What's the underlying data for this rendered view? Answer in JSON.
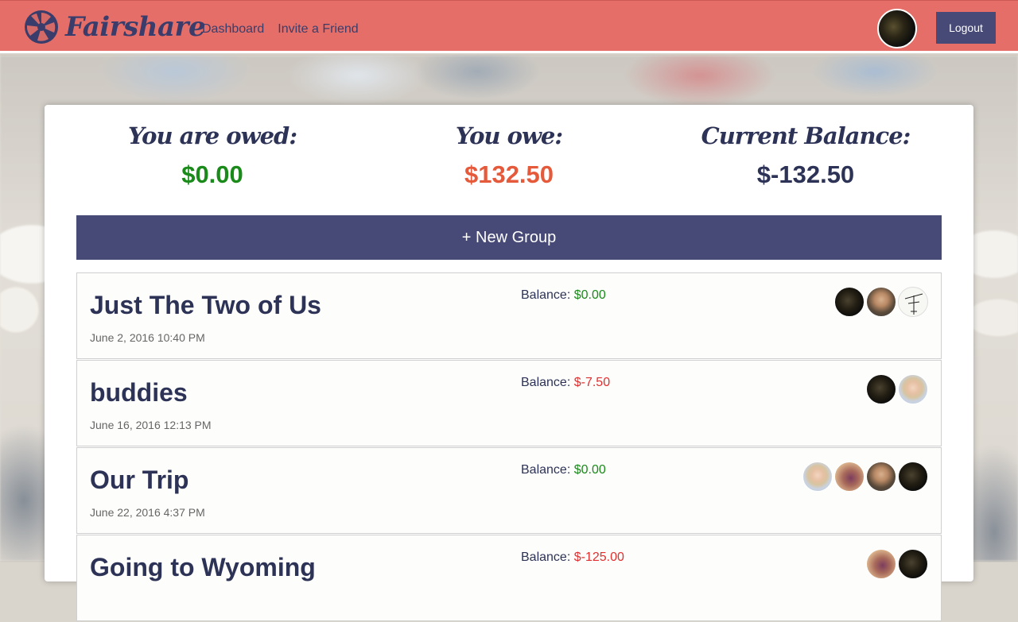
{
  "header": {
    "brand": "Fairshare",
    "nav": [
      {
        "label": "Dashboard"
      },
      {
        "label": "Invite a Friend"
      }
    ],
    "logout_label": "Logout",
    "colors": {
      "bar": "#e56f68",
      "brand_text": "#3a3d6b",
      "button": "#474a77"
    }
  },
  "summary": {
    "owed_label": "You are owed:",
    "owed_value": "$0.00",
    "owe_label": "You owe:",
    "owe_value": "$132.50",
    "balance_label": "Current Balance:",
    "balance_value": "$-132.50"
  },
  "new_group_label": "+ New Group",
  "balance_prefix": "Balance:",
  "groups": [
    {
      "name": "Just The Two of Us",
      "date": "June 2, 2016 10:40 PM",
      "balance": "$0.00",
      "balance_status": "positive",
      "avatars": [
        "dark-photo",
        "man-photo",
        "sketch"
      ]
    },
    {
      "name": "buddies",
      "date": "June 16, 2016 12:13 PM",
      "balance": "$-7.50",
      "balance_status": "negative",
      "avatars": [
        "dark-photo",
        "woman-photo"
      ]
    },
    {
      "name": "Our Trip",
      "date": "June 22, 2016 4:37 PM",
      "balance": "$0.00",
      "balance_status": "positive",
      "avatars": [
        "woman-photo",
        "purple-photo",
        "man-photo",
        "dark-photo"
      ]
    },
    {
      "name": "Going to Wyoming",
      "date": "",
      "balance": "$-125.00",
      "balance_status": "negative",
      "avatars": [
        "purple-photo",
        "dark-photo"
      ]
    }
  ]
}
